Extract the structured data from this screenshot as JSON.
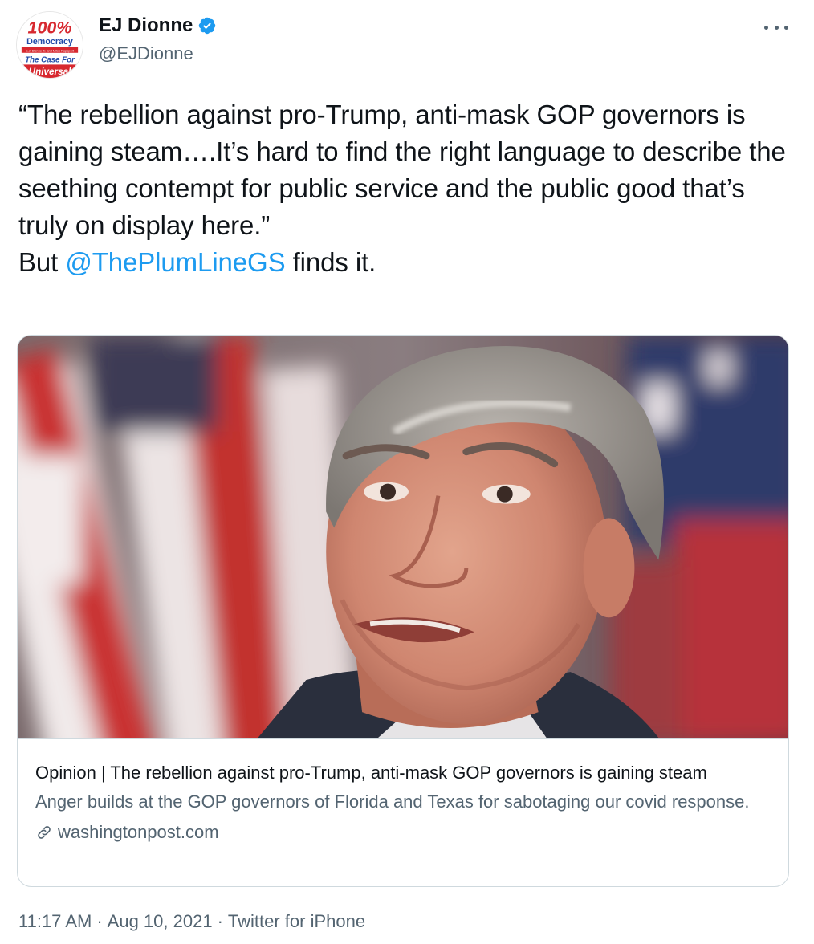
{
  "author": {
    "display_name": "EJ Dionne",
    "handle": "@EJDionne",
    "avatar_text": {
      "line1": "100%",
      "line2": "Democracy",
      "line3": "E.J. Dionne Jr. and Miles Rapoport",
      "line4": "The Case For",
      "line5": "Universal"
    }
  },
  "tweet": {
    "paragraph1": "“The rebellion against pro-Trump, anti-mask GOP governors is gaining steam….It’s hard to find the right language to describe the seething contempt for public service and the public good that’s truly on display here.”",
    "paragraph2_prefix": "But ",
    "mention": "@ThePlumLineGS",
    "paragraph2_suffix": " finds it."
  },
  "card": {
    "title": "Opinion | The rebellion against pro-Trump, anti-mask GOP governors is gaining steam",
    "description": "Anger builds at the GOP governors of Florida and Texas for sabotaging our covid response.",
    "domain": "washingtonpost.com"
  },
  "footer": {
    "time": "11:17 AM",
    "separator": "·",
    "date": "Aug 10, 2021",
    "source": "Twitter for iPhone"
  },
  "colors": {
    "accent": "#1d9bf0",
    "text": "#0f1419",
    "secondary": "#536471",
    "border": "#cfd9de"
  },
  "icons": {
    "verified": "verified-badge-icon",
    "more": "more-options-icon",
    "link": "link-icon"
  }
}
